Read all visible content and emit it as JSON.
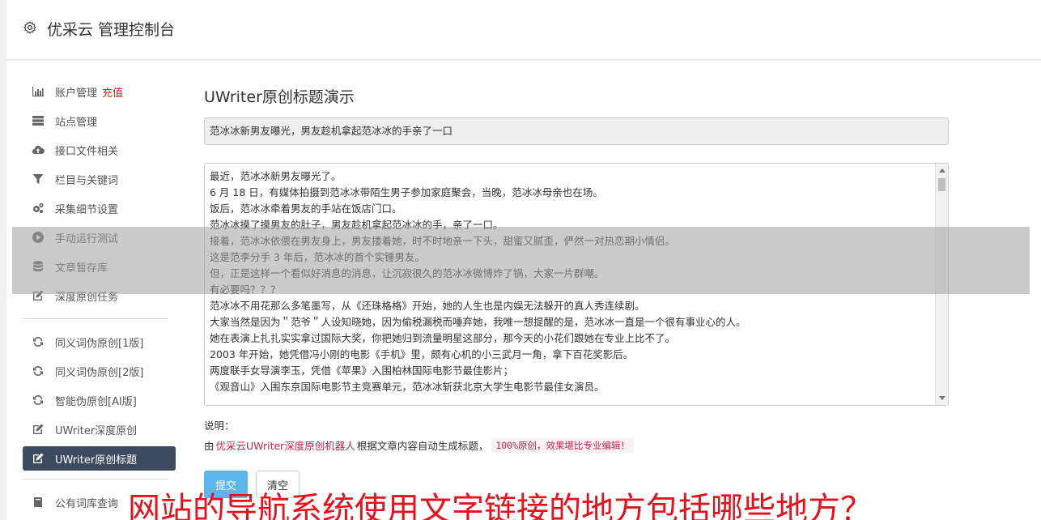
{
  "header": {
    "title": "优采云 管理控制台"
  },
  "sidebar": {
    "group1": [
      {
        "label": "账户管理",
        "badge": "充值",
        "icon": "bar-chart-icon"
      },
      {
        "label": "站点管理",
        "icon": "server-icon"
      },
      {
        "label": "接口文件相关",
        "icon": "cloud-upload-icon"
      },
      {
        "label": "栏目与关键词",
        "icon": "filter-icon"
      },
      {
        "label": "采集细节设置",
        "icon": "cogs-icon"
      },
      {
        "label": "手动运行测试",
        "icon": "play-circle-icon"
      },
      {
        "label": "文章暂存库",
        "icon": "database-icon"
      },
      {
        "label": "深度原创任务",
        "icon": "edit-icon"
      }
    ],
    "group2": [
      {
        "label": "同义词伪原创[1版]",
        "icon": "refresh-icon"
      },
      {
        "label": "同义词伪原创[2版]",
        "icon": "refresh-icon"
      },
      {
        "label": "智能伪原创[AI版]",
        "icon": "refresh-icon"
      },
      {
        "label": "UWriter深度原创",
        "icon": "edit-icon"
      },
      {
        "label": "UWriter原创标题",
        "icon": "edit-icon",
        "active": true
      }
    ],
    "group3": [
      {
        "label": "公有词库查询",
        "icon": "book-icon"
      }
    ]
  },
  "content": {
    "heading": "UWriter原创标题演示",
    "title_value": "范冰冰新男友曝光，男友趁机拿起范冰冰的手亲了一口",
    "article_lines": [
      "最近，范冰冰新男友曝光了。",
      "6 月 18 日，有媒体拍摄到范冰冰带陌生男子参加家庭聚会，当晚，范冰冰母亲也在场。",
      "饭后，范冰冰牵着男友的手站在饭店门口。",
      "范冰冰摸了摸男友的肚子，男友趁机拿起范冰冰的手，亲了一口。",
      "接着，范冰冰依偎在男友身上，男友搂着她，时不时地亲一下头，甜蜜又腻歪，俨然一对热恋期小情侣。",
      "这是范李分手 3 年后，范冰冰的首个实锤男友。",
      "但，正是这样一个看似好消息的消息，让沉寂很久的范冰冰微博炸了锅，大家一片群嘲。",
      "有必要吗？？？",
      "范冰冰不用花那么多笔墨写，从《还珠格格》开始，她的人生也是内娱无法躲开的真人秀连续剧。",
      "大家当然是因为＂范爷＂人设知晓她，因为偷税漏税而唾弃她，我唯一想提醒的是，范冰冰一直是一个很有事业心的人。",
      "她在表演上扎扎实实拿过国际大奖，你把她归到流量明星这部分，那今天的小花们跟她在专业上比不了。",
      "2003 年开始，她凭借冯小刚的电影《手机》里，颇有心机的小三武月一角，拿下百花奖影后。",
      "两度联手女导演李玉，凭借《苹果》入围柏林国际电影节最佳影片；",
      "《观音山》入围东京国际电影节主竞赛单元，范冰冰斩获北京大学生电影节最佳女演员。"
    ],
    "note_label": "说明：",
    "note_prefix": "由",
    "note_highlight": "优采云UWriter深度原创机器人",
    "note_middle": "根据文章内容自动生成标题，",
    "note_code": "100%原创，效果堪比专业编辑！",
    "submit_label": "提交",
    "clear_label": "清空"
  },
  "overlay": {
    "caption": "网站的导航系统使用文字链接的地方包括哪些地方？"
  }
}
